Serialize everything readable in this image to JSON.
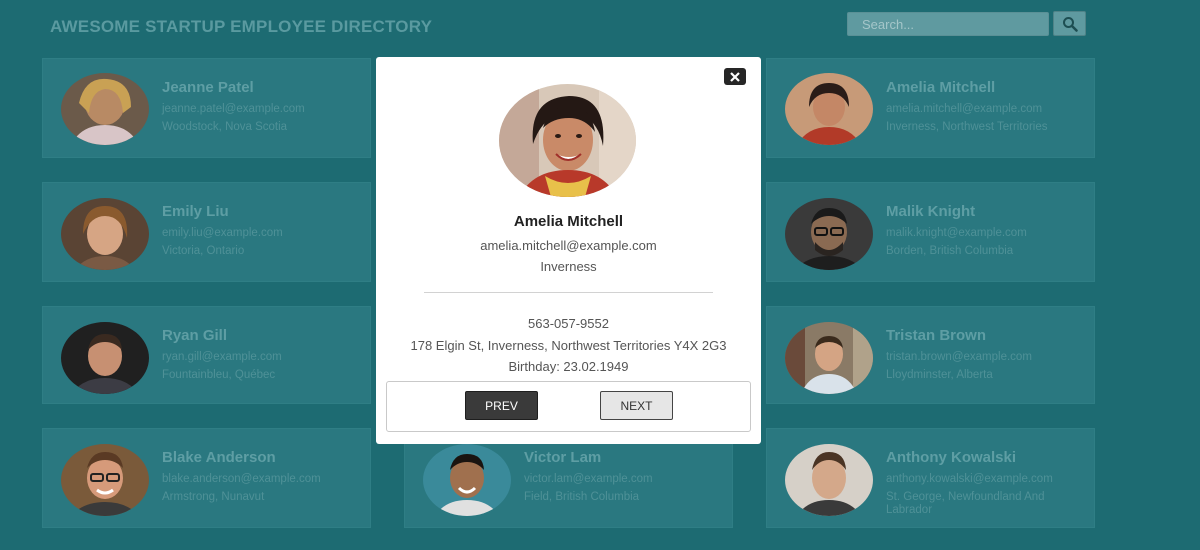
{
  "header": {
    "title": "AWESOME STARTUP EMPLOYEE DIRECTORY",
    "search_placeholder": "Search...",
    "search_icon": "magnifier-icon"
  },
  "employees": [
    {
      "name": "Jeanne Patel",
      "email": "jeanne.patel@example.com",
      "location": "Woodstock, Nova Scotia"
    },
    {
      "name": "Amelia Mitchell",
      "email": "amelia.mitchell@example.com",
      "location": "Inverness, Northwest Territories"
    },
    {
      "name": "Emily Liu",
      "email": "emily.liu@example.com",
      "location": "Victoria, Ontario"
    },
    {
      "name": "Malik Knight",
      "email": "malik.knight@example.com",
      "location": "Borden, British Columbia"
    },
    {
      "name": "Ryan Gill",
      "email": "ryan.gill@example.com",
      "location": "Fountainbleu, Québec"
    },
    {
      "name": "Tristan Brown",
      "email": "tristan.brown@example.com",
      "location": "Lloydminster, Alberta"
    },
    {
      "name": "Blake Anderson",
      "email": "blake.anderson@example.com",
      "location": "Armstrong, Nunavut"
    },
    {
      "name": "Victor Lam",
      "email": "victor.lam@example.com",
      "location": "Field, British Columbia"
    },
    {
      "name": "Anthony Kowalski",
      "email": "anthony.kowalski@example.com",
      "location": "St. George, Newfoundland And Labrador"
    }
  ],
  "modal": {
    "close_label": "×",
    "name": "Amelia Mitchell",
    "email": "amelia.mitchell@example.com",
    "city": "Inverness",
    "phone": "563-057-9552",
    "address": "178 Elgin St, Inverness, Northwest Territories Y4X 2G3",
    "birthday": "Birthday: 23.02.1949",
    "prev_label": "PREV",
    "next_label": "NEXT"
  },
  "colors": {
    "background": "#1d6b72",
    "card": "#2a7880",
    "modal": "#ffffff",
    "prev_button": "#3a3a3a",
    "next_button": "#e6e6e6"
  }
}
